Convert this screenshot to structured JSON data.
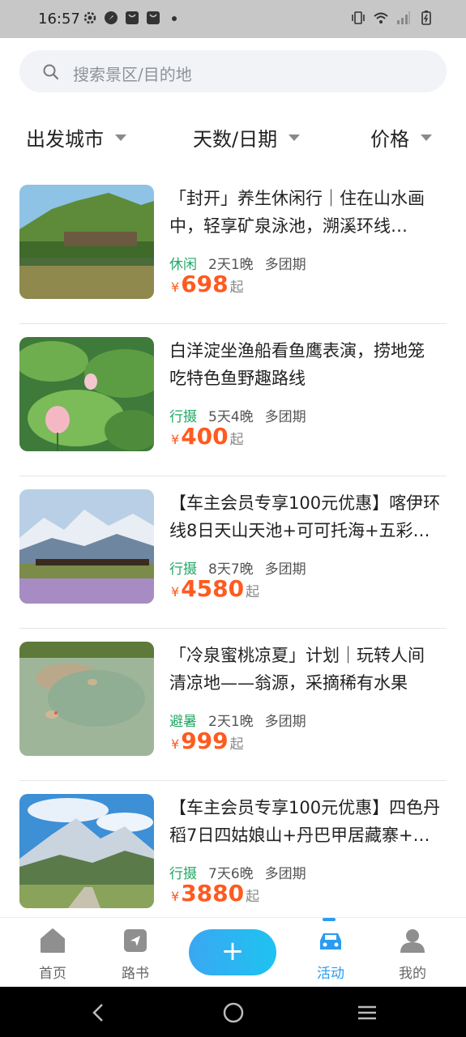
{
  "status": {
    "time": "16:57"
  },
  "search": {
    "placeholder": "搜索景区/目的地"
  },
  "filters": [
    {
      "label": "出发城市"
    },
    {
      "label": "天数/日期"
    },
    {
      "label": "价格"
    }
  ],
  "items": [
    {
      "title": "「封开」养生休闲行｜住在山水画中，轻享矿泉泳池，溯溪环线…",
      "category": "休闲",
      "days": "2天1晚",
      "group": "多团期",
      "currency": "¥",
      "price": "698",
      "suffix": "起"
    },
    {
      "title": "白洋淀坐渔船看鱼鹰表演，捞地笼吃特色鱼野趣路线",
      "category": "行摄",
      "days": "5天4晚",
      "group": "多团期",
      "currency": "¥",
      "price": "400",
      "suffix": "起"
    },
    {
      "title": "【车主会员专享100元优惠】喀伊环线8日天山天池+可可托海+五彩…",
      "category": "行摄",
      "days": "8天7晚",
      "group": "多团期",
      "currency": "¥",
      "price": "4580",
      "suffix": "起"
    },
    {
      "title": "「冷泉蜜桃凉夏」计划｜玩转人间清凉地——翁源，采摘稀有水果九…",
      "category": "避暑",
      "days": "2天1晚",
      "group": "多团期",
      "currency": "¥",
      "price": "999",
      "suffix": "起"
    },
    {
      "title": "【车主会员专享100元优惠】四色丹稻7日四姑娘山+丹巴甲居藏寨+…",
      "category": "行摄",
      "days": "7天6晚",
      "group": "多团期",
      "currency": "¥",
      "price": "3880",
      "suffix": "起"
    }
  ],
  "tabbar": {
    "home": "首页",
    "route": "路书",
    "plus": "+",
    "activity": "活动",
    "mine": "我的"
  },
  "colors": {
    "accent": "#2a9cf0",
    "price": "#ff5a1f",
    "category": "#22a866"
  }
}
